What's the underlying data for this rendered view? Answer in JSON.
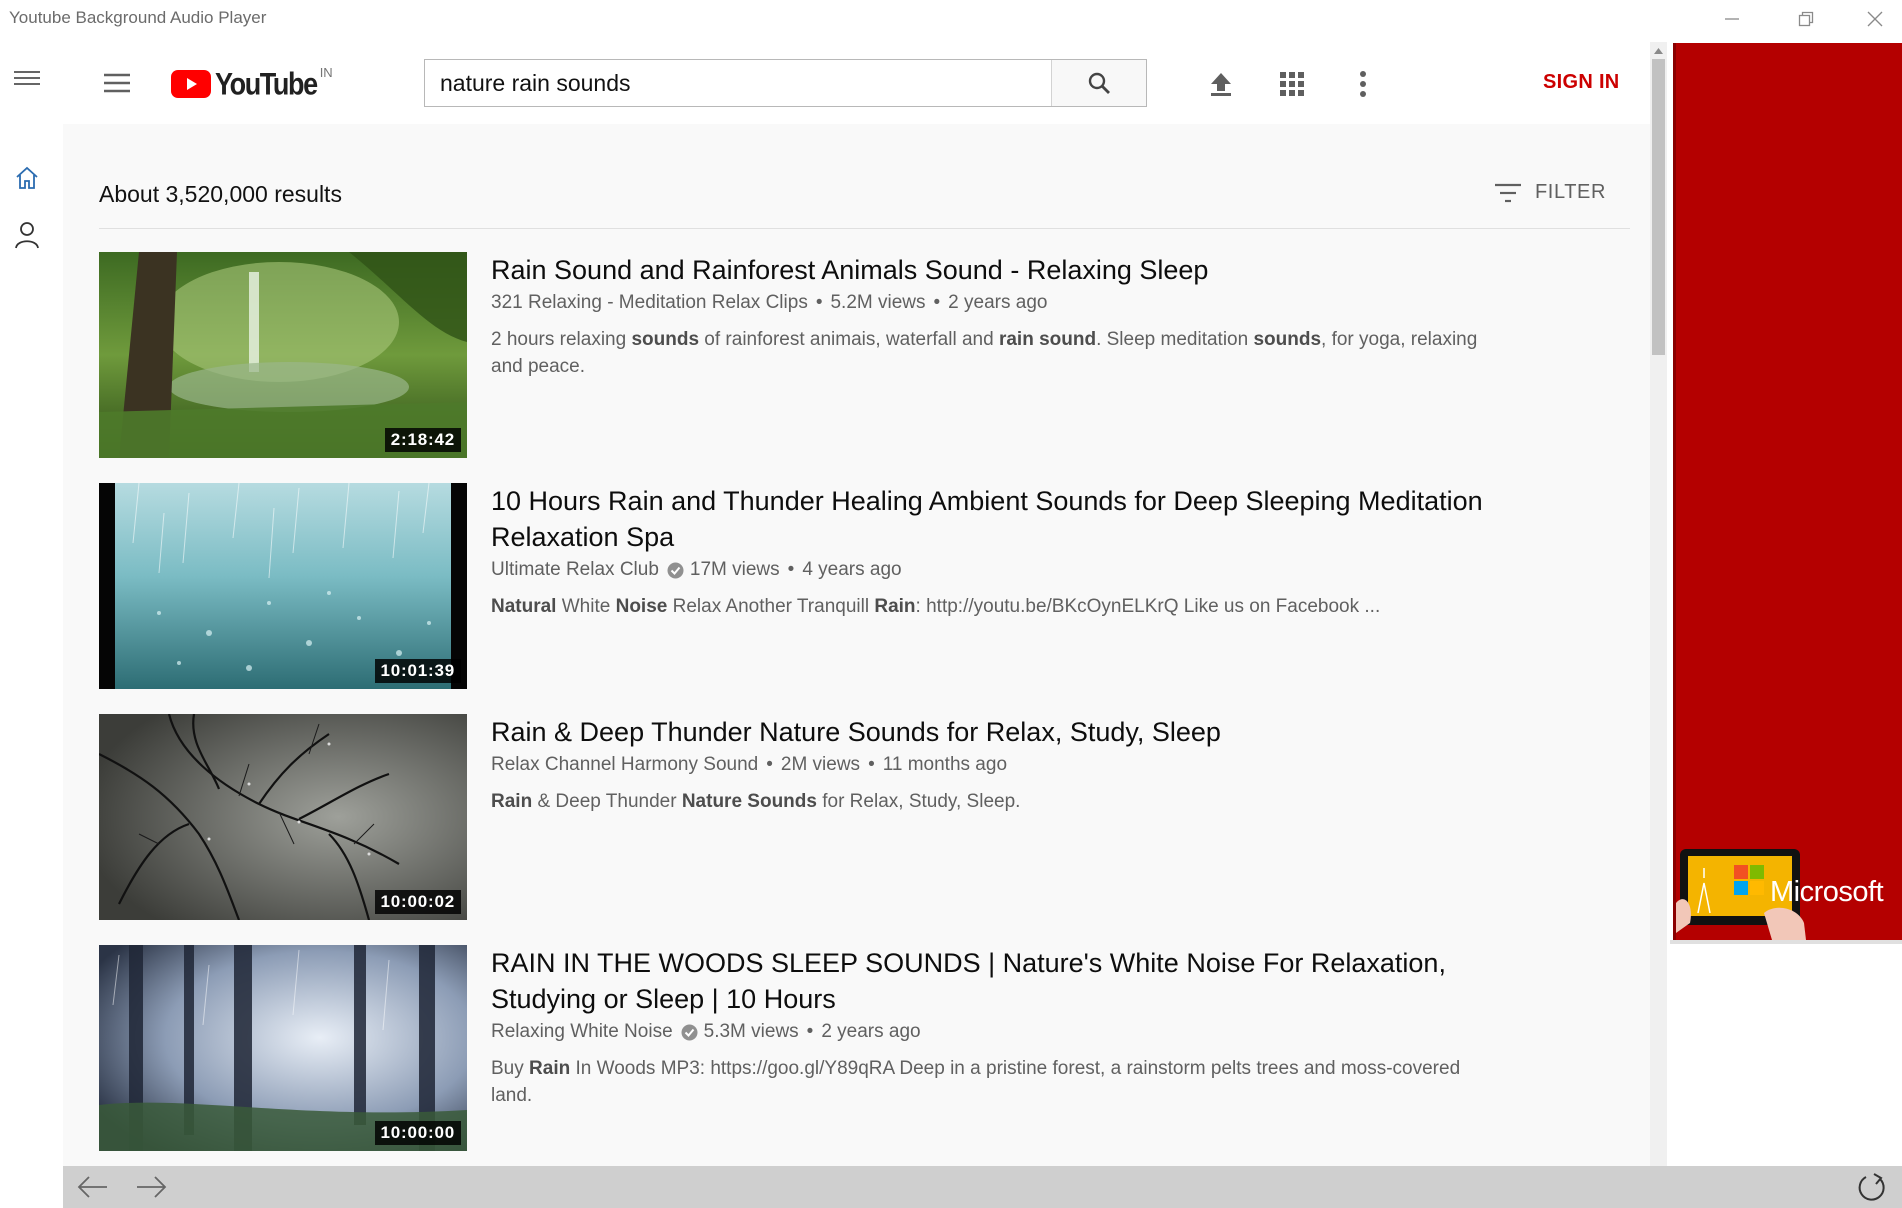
{
  "window": {
    "title": "Youtube Background Audio Player"
  },
  "header": {
    "region": "IN",
    "logo_text": "YouTube",
    "search_value": "nature rain sounds",
    "sign_in": "SIGN IN"
  },
  "results": {
    "count": "About 3,520,000 results",
    "filter_label": "FILTER",
    "items": [
      {
        "title": "Rain Sound and Rainforest Animals Sound - Relaxing Sleep",
        "channel": "321 Relaxing - Meditation Relax Clips",
        "verified": false,
        "views": "5.2M views",
        "age": "2 years ago",
        "duration": "2:18:42",
        "desc_html": "2 hours relaxing <b>sounds</b> of rainforest animais, waterfall and <b>rain sound</b>. Sleep meditation <b>sounds</b>, for yoga, relaxing and peace."
      },
      {
        "title": "10 Hours Rain and Thunder Healing Ambient Sounds for Deep Sleeping Meditation Relaxation Spa",
        "channel": "Ultimate Relax Club",
        "verified": true,
        "views": "17M views",
        "age": "4 years ago",
        "duration": "10:01:39",
        "desc_html": "<b>Natural</b> White <b>Noise</b> Relax Another Tranquill <b>Rain</b>: http://youtu.be/BKcOynELKrQ Like us on Facebook ..."
      },
      {
        "title": "Rain & Deep Thunder Nature Sounds for Relax, Study, Sleep",
        "channel": "Relax Channel Harmony Sound",
        "verified": false,
        "views": "2M views",
        "age": "11 months ago",
        "duration": "10:00:02",
        "desc_html": "<b>Rain</b> & Deep Thunder <b>Nature Sounds</b> for Relax, Study, Sleep."
      },
      {
        "title": "RAIN IN THE WOODS SLEEP SOUNDS | Nature's White Noise For Relaxation, Studying or Sleep | 10 Hours",
        "channel": "Relaxing White Noise",
        "verified": true,
        "views": "5.3M views",
        "age": "2 years ago",
        "duration": "10:00:00",
        "desc_html": "Buy <b>Rain</b> In Woods MP3: https://goo.gl/Y89qRA Deep in a pristine forest, a rainstorm pelts trees and moss-covered land."
      }
    ]
  },
  "ad": {
    "brand": "Microsoft",
    "background": "#b40000"
  },
  "colors": {
    "brand_red": "#ff0000",
    "sign_in_red": "#cc0000",
    "rail_accent": "#2b6cb0"
  },
  "icons": [
    "hamburger-icon",
    "home-icon",
    "person-icon",
    "search-icon",
    "upload-icon",
    "apps-grid-icon",
    "more-vert-icon",
    "filter-icon",
    "verified-icon",
    "back-arrow-icon",
    "forward-arrow-icon",
    "refresh-icon"
  ]
}
